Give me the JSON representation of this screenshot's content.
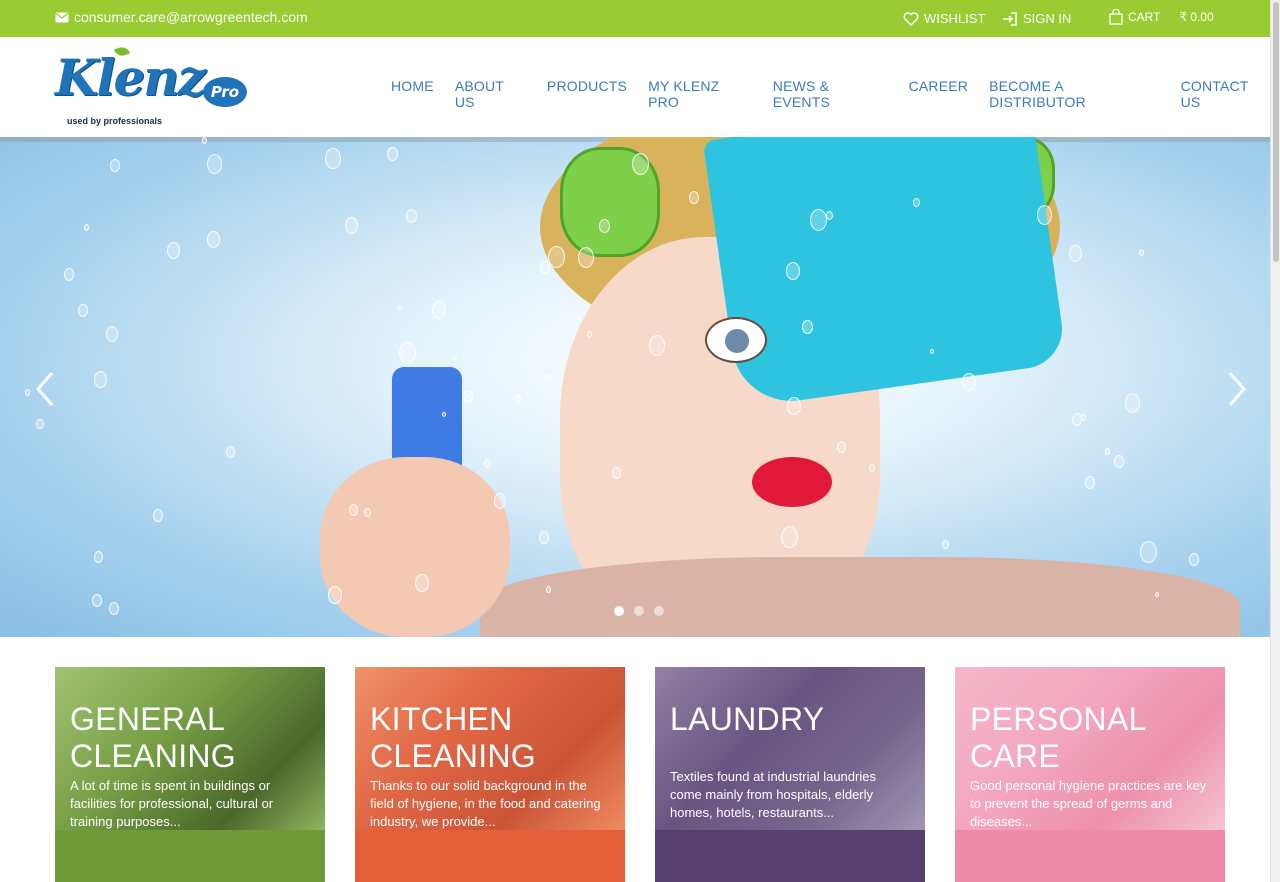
{
  "topbar": {
    "email": "consumer.care@arrowgreentech.com",
    "wishlist": "WISHLIST",
    "signin": "SIGN IN",
    "cart": "CART",
    "cart_amount": "₹ 0.00"
  },
  "logo": {
    "brand": "Klenz",
    "pro": "Pro",
    "tagline": "used by professionals"
  },
  "nav": {
    "items": [
      "HOME",
      "ABOUT US",
      "PRODUCTS",
      "MY KLENZ PRO",
      "NEWS & EVENTS",
      "CAREER",
      "BECOME A DISTRIBUTOR",
      "CONTACT US"
    ]
  },
  "carousel": {
    "slide_count": 3,
    "active_slide": 1
  },
  "categories": [
    {
      "title_line1": "GENERAL",
      "title_line2": "CLEANING",
      "description": "A lot of time is spent in buildings or facilities for professional, cultural or training purposes..."
    },
    {
      "title_line1": "KITCHEN",
      "title_line2": "CLEANING",
      "description": "Thanks to our solid background in the field of hygiene, in the food and catering industry, we provide..."
    },
    {
      "title_line1": "LAUNDRY",
      "title_line2": "",
      "description": "Textiles found at industrial laundries come mainly from hospitals, elderly homes, hotels, restaurants..."
    },
    {
      "title_line1": "PERSONAL",
      "title_line2": "CARE",
      "description": "Good personal hygiene practices are key to prevent the spread of germs and diseases..."
    }
  ],
  "colors": {
    "topbar": "#99cc33",
    "nav_link": "#3a7bbf",
    "general_cleaning": "#6f9a3a",
    "kitchen_cleaning": "#e55f3b",
    "laundry": "#574070",
    "personal_care": "#f08aaa"
  },
  "icons": {
    "email": "envelope-icon",
    "wishlist": "heart-icon",
    "signin": "sign-in-icon",
    "cart": "shopping-bag-icon",
    "prev": "chevron-left-icon",
    "next": "chevron-right-icon"
  }
}
